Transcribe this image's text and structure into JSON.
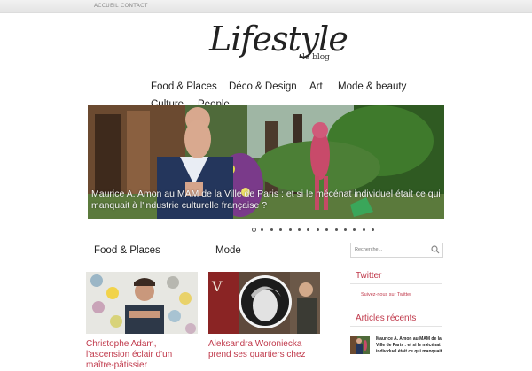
{
  "topbar": {
    "links": [
      "ACCUEIL",
      "CONTACT"
    ]
  },
  "logo": {
    "title": "Lifestyle",
    "subtitle": "le blog"
  },
  "nav": {
    "items": [
      "Food & Places",
      "Déco & Design",
      "Art",
      "Mode & beauty",
      "Culture",
      "People"
    ]
  },
  "slider": {
    "caption": "Maurice A. Amon au MAM de la Ville de Paris : et si le mécénat individuel était ce qui manquait à l'industrie culturelle française ?",
    "slide_count": 14,
    "active_index": 0
  },
  "sections": {
    "left": "Food & Places",
    "right": "Mode"
  },
  "posts": [
    {
      "title": "Christophe Adam, l'ascension éclair d'un maître-pâtissier"
    },
    {
      "title": "Aleksandra Woroniecka prend ses quartiers chez"
    }
  ],
  "sidebar": {
    "search_placeholder": "Recherche...",
    "twitter_title": "Twitter",
    "twitter_link": "Suivez-nous sur Twitter",
    "recent_title": "Articles récents",
    "recent_item": "Maurice A. Amon au MAM de la Ville de Paris : et si le mécénat individuel était ce qui manquait"
  },
  "colors": {
    "accent": "#c0394b",
    "text": "#222222",
    "topbar": "#ececec"
  }
}
